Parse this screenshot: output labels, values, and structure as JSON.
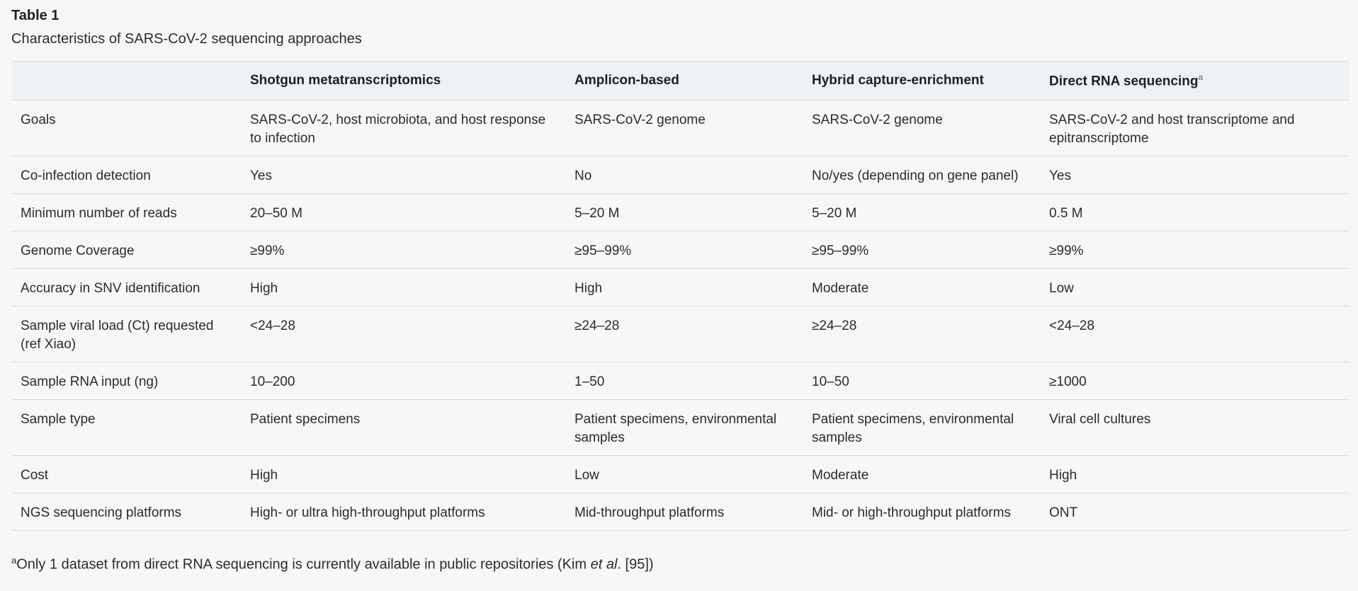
{
  "table": {
    "label": "Table 1",
    "caption": "Characteristics of SARS-CoV-2 sequencing approaches",
    "headers": [
      "",
      "Shotgun metatranscriptomics",
      "Amplicon-based",
      "Hybrid capture-enrichment",
      "Direct RNA sequencing"
    ],
    "header_footnote_mark": "a",
    "rows": [
      [
        "Goals",
        "SARS-CoV-2, host microbiota, and host response to infection",
        "SARS-CoV-2 genome",
        "SARS-CoV-2 genome",
        "SARS-CoV-2 and host transcriptome and epitranscriptome"
      ],
      [
        "Co-infection detection",
        "Yes",
        "No",
        "No/yes (depending on gene panel)",
        "Yes"
      ],
      [
        "Minimum number of reads",
        "20–50 M",
        "5–20 M",
        "5–20 M",
        "0.5 M"
      ],
      [
        "Genome Coverage",
        "≥99%",
        "≥95–99%",
        "≥95–99%",
        "≥99%"
      ],
      [
        "Accuracy in SNV identification",
        "High",
        "High",
        "Moderate",
        "Low"
      ],
      [
        "Sample viral load (Ct) requested (ref Xiao)",
        "<24–28",
        "≥24–28",
        "≥24–28",
        "<24–28"
      ],
      [
        "Sample RNA input (ng)",
        "10–200",
        "1–50",
        "10–50",
        "≥1000"
      ],
      [
        "Sample type",
        "Patient specimens",
        "Patient specimens, environmental samples",
        "Patient specimens, environmental samples",
        "Viral cell cultures"
      ],
      [
        "Cost",
        "High",
        "Low",
        "Moderate",
        "High"
      ],
      [
        "NGS sequencing platforms",
        "High- or ultra high-throughput platforms",
        "Mid-throughput platforms",
        "Mid- or high-throughput platforms",
        "ONT"
      ]
    ]
  },
  "footnote": {
    "mark": "a",
    "text_before": "Only 1 dataset from direct RNA sequencing is currently available in public repositories (Kim ",
    "italic": "et al",
    "text_after": ". [95])"
  }
}
